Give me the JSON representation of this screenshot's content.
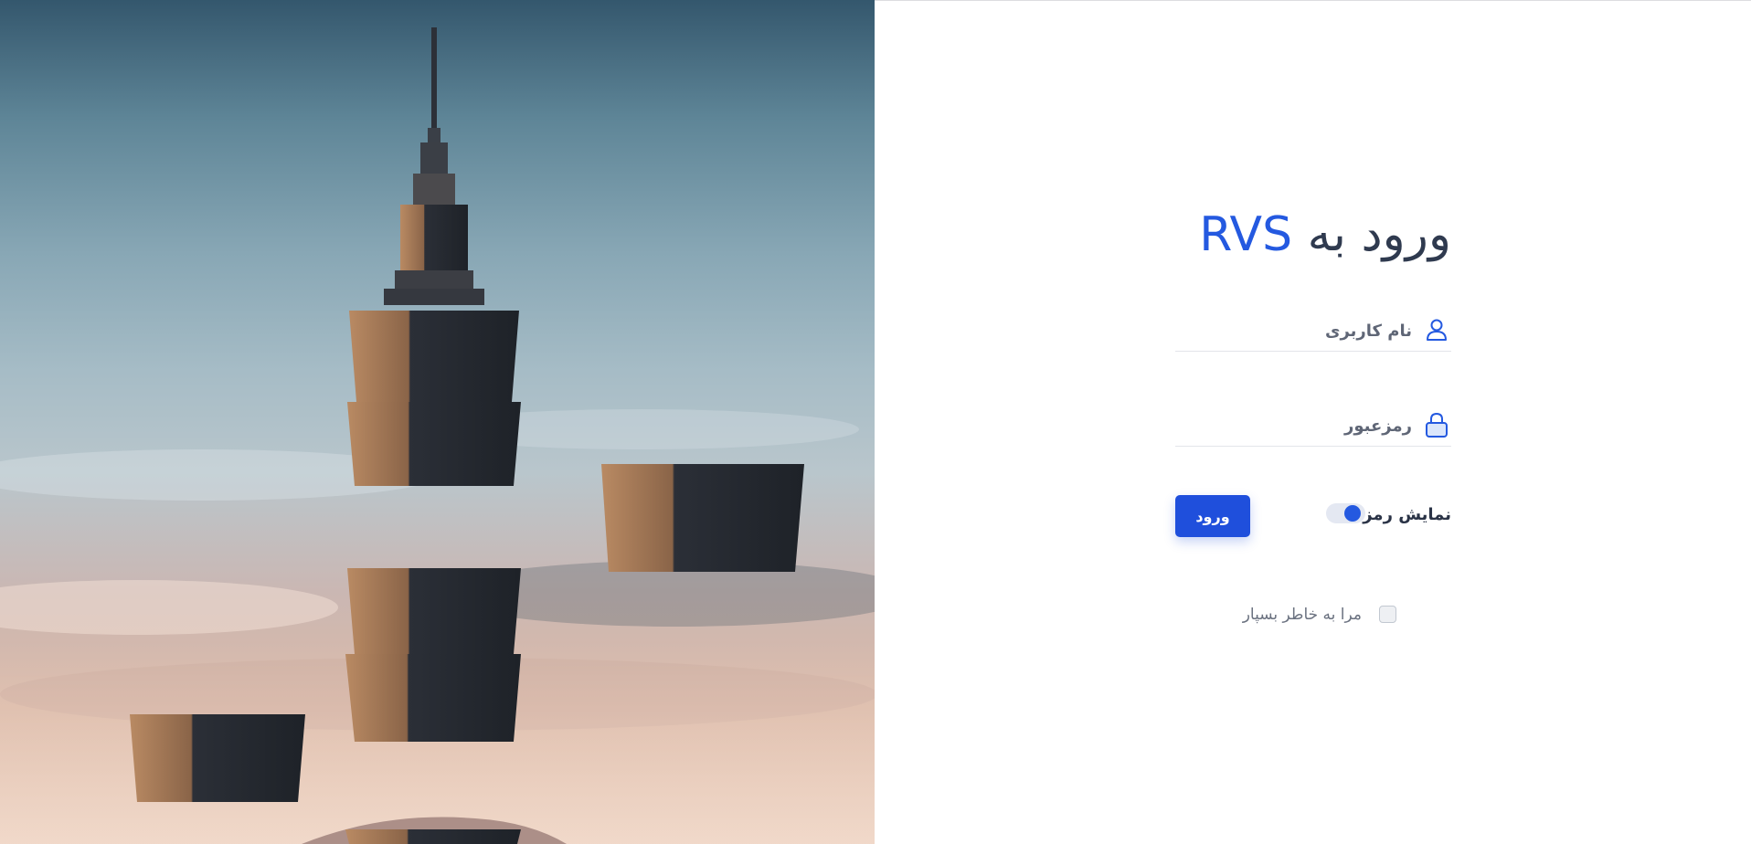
{
  "login": {
    "title_prefix": "ورود به",
    "brand": "RVS",
    "username_label": "نام کاربری",
    "username_value": "",
    "password_label": "رمزعبور",
    "password_value": "",
    "show_password_label": "نمایش رمز",
    "show_password_on": true,
    "login_button": "ورود",
    "remember_label": "مرا به خاطر بسپار",
    "remember_checked": false
  },
  "theme": {
    "accent": "#1f4fdc",
    "title_color": "#2f3a4f",
    "label_color": "#5f6676"
  },
  "icons": {
    "username": "user-icon",
    "password": "lock-icon"
  }
}
